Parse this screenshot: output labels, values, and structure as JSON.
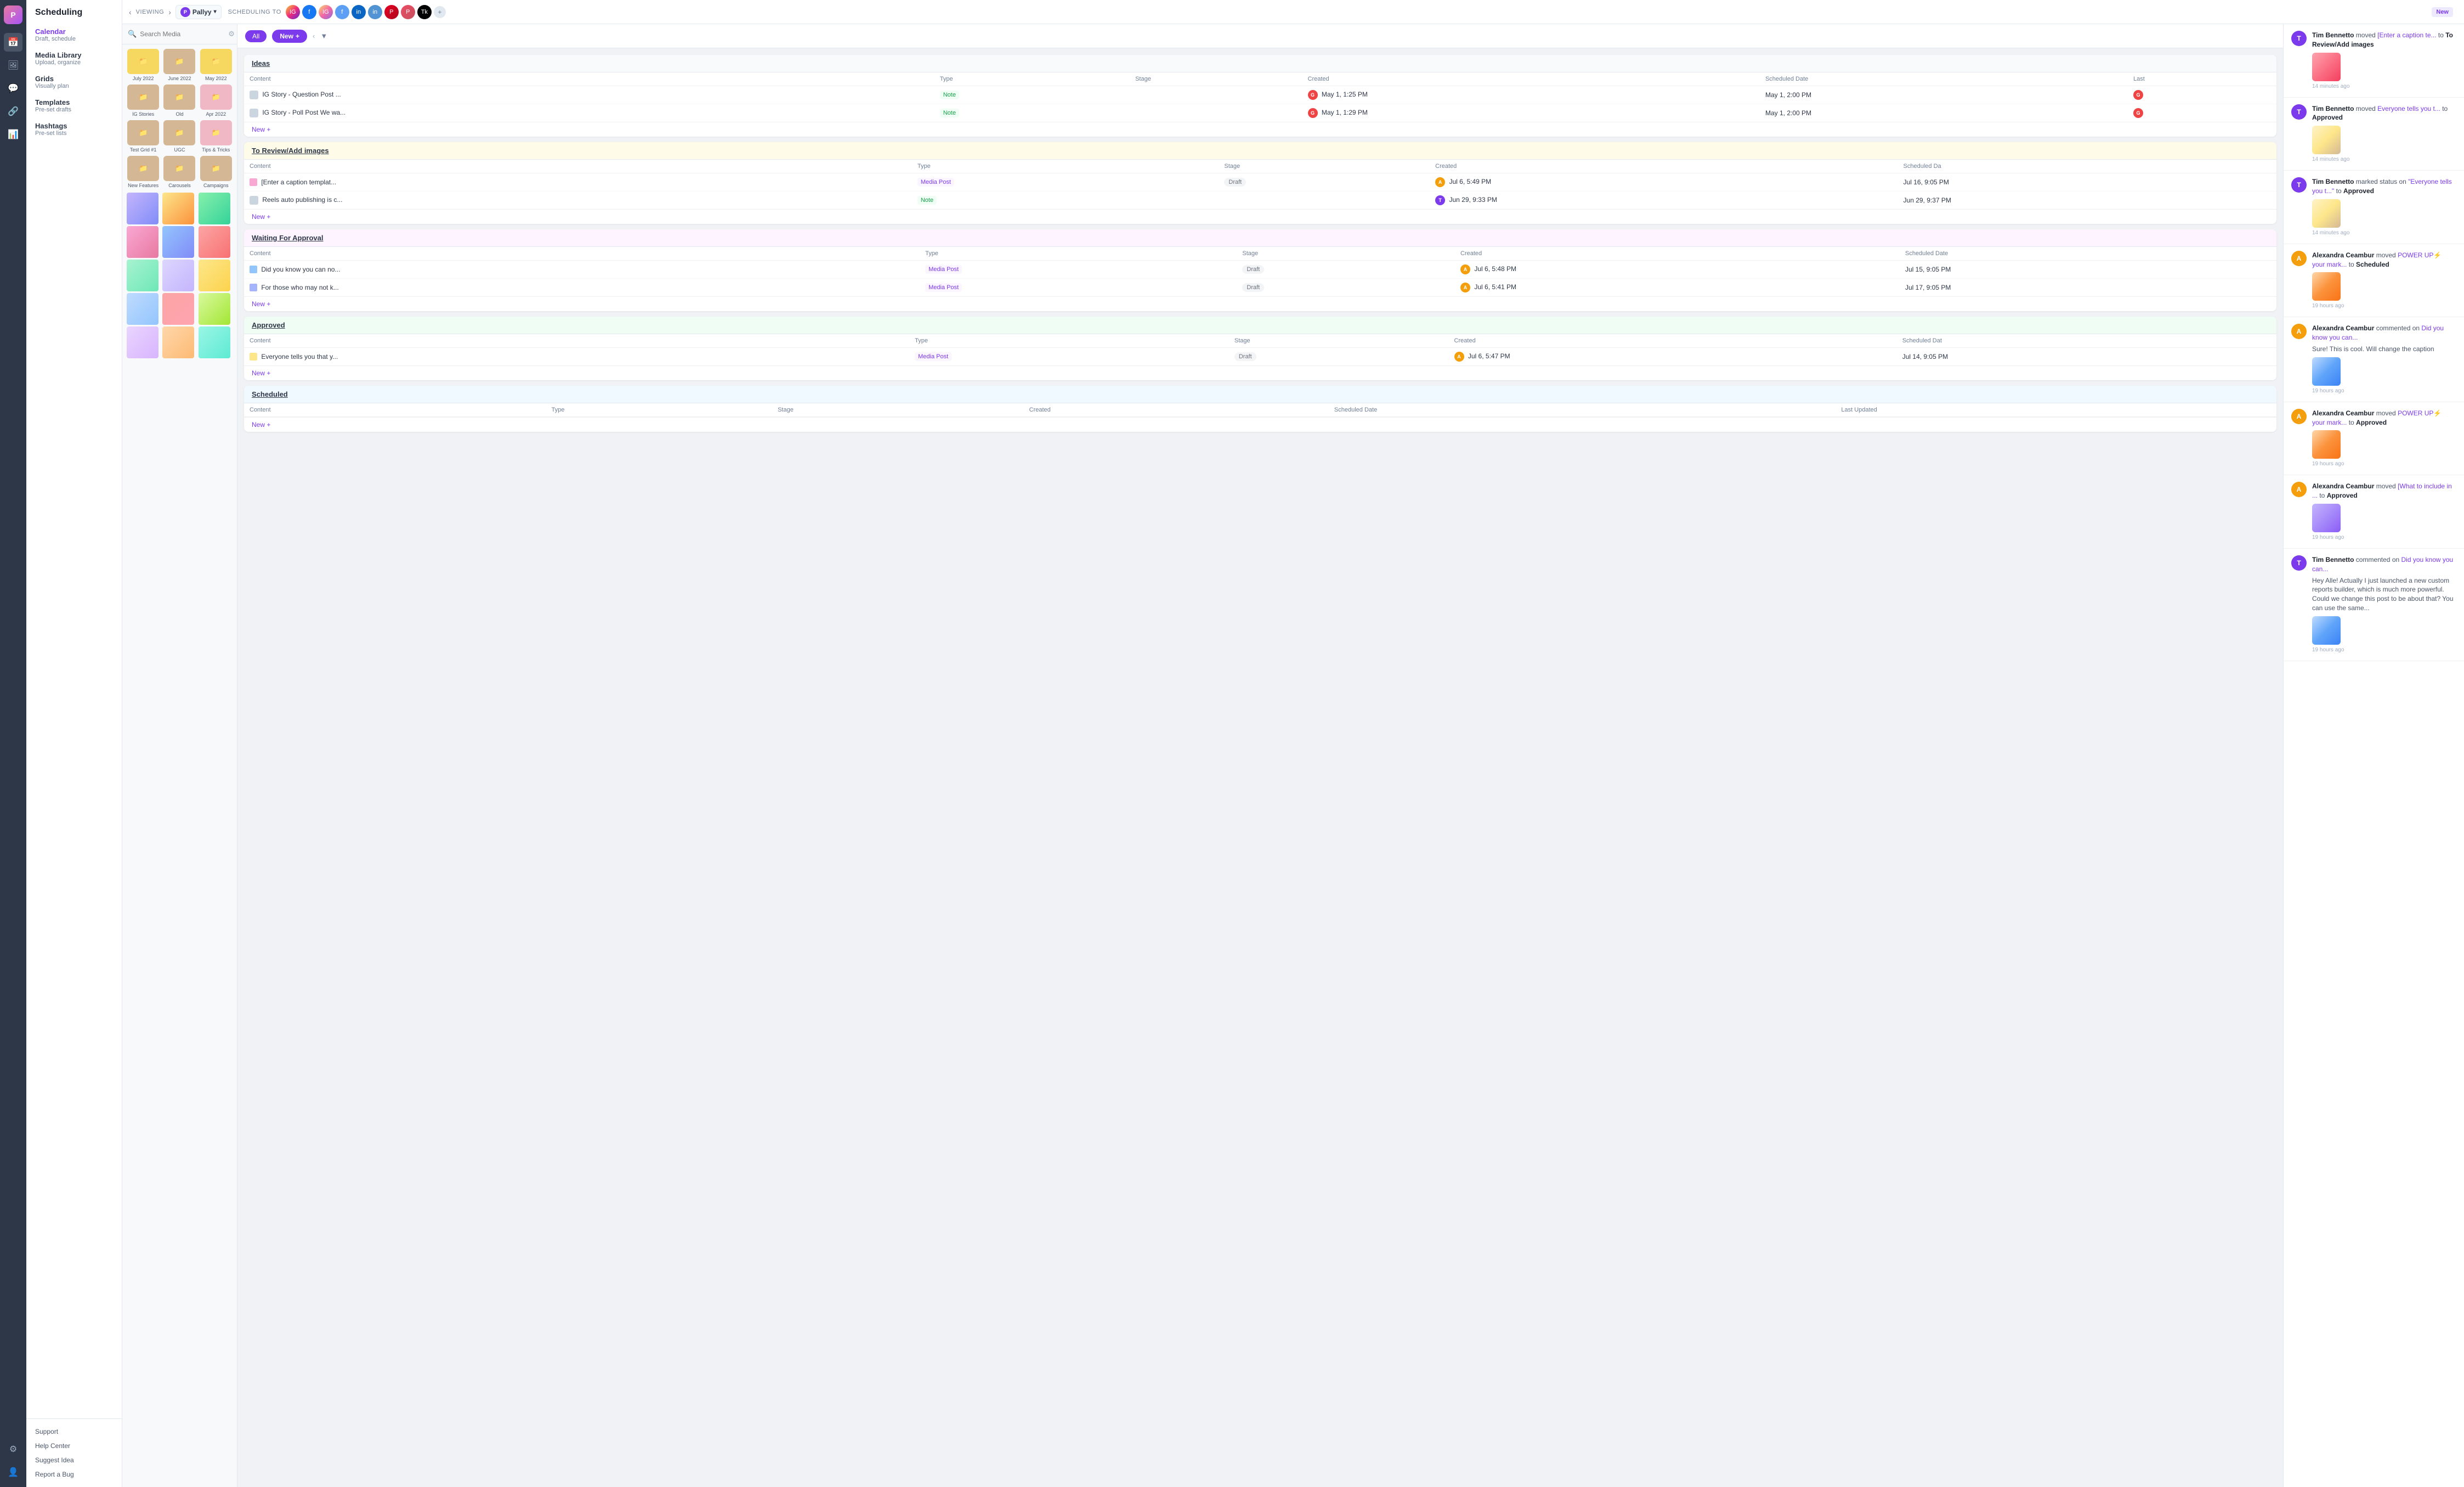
{
  "app": {
    "name": "Scheduling",
    "logo": "P"
  },
  "topbar": {
    "viewing_label": "VIEWING",
    "brand_name": "Pallyy",
    "scheduling_to_label": "SCHEDULING TO",
    "new_button": "New",
    "filter_all": "All",
    "nav_back": "‹",
    "nav_forward": "›"
  },
  "sidebar": {
    "items": [
      {
        "label": "Calendar",
        "sublabel": "Draft, schedule"
      },
      {
        "label": "Media Library",
        "sublabel": "Upload, organize"
      },
      {
        "label": "Grids",
        "sublabel": "Visually plan"
      },
      {
        "label": "Templates",
        "sublabel": "Pre-set drafts"
      },
      {
        "label": "Hashtags",
        "sublabel": "Pre-set lists"
      }
    ],
    "bottom": [
      "Support",
      "Help Center",
      "Suggest Idea",
      "Report a Bug"
    ]
  },
  "media": {
    "search_placeholder": "Search Media",
    "folders": [
      {
        "label": "July 2022",
        "color": "yellow"
      },
      {
        "label": "June 2022",
        "color": "tan"
      },
      {
        "label": "May 2022",
        "color": "yellow"
      },
      {
        "label": "IG Stories",
        "color": "tan"
      },
      {
        "label": "Old",
        "color": "tan"
      },
      {
        "label": "Apr 2022",
        "color": "pink"
      },
      {
        "label": "Test Grid #1",
        "color": "tan"
      },
      {
        "label": "UGC",
        "color": "tan"
      },
      {
        "label": "Tips & Tricks",
        "color": "pink"
      },
      {
        "label": "New Features",
        "color": "tan"
      },
      {
        "label": "Carousels",
        "color": "tan"
      },
      {
        "label": "Campaigns",
        "color": "tan"
      }
    ]
  },
  "kanban": {
    "sections": [
      {
        "id": "ideas",
        "title": "Ideas",
        "columns": [
          "Content",
          "Type",
          "Stage",
          "Created",
          "Scheduled Date",
          "Last"
        ],
        "rows": [
          {
            "content": "IG Story - Question Post ...",
            "type": "Note",
            "type_class": "type-note",
            "stage": "",
            "avatar": "G",
            "avatar_class": "avatar-g",
            "created": "May 1, 1:25 PM",
            "scheduled": "May 1, 2:00 PM",
            "last": "G N"
          },
          {
            "content": "IG Story - Poll Post We wa...",
            "type": "Note",
            "type_class": "type-note",
            "stage": "",
            "avatar": "G",
            "avatar_class": "avatar-g",
            "created": "May 1, 1:29 PM",
            "scheduled": "May 1, 2:00 PM",
            "last": "G N"
          }
        ],
        "new_btn": "New +"
      },
      {
        "id": "review",
        "title": "To Review/Add images",
        "columns": [
          "Content",
          "Type",
          "Stage",
          "Created",
          "Scheduled Da"
        ],
        "rows": [
          {
            "content": "[Enter a caption templat...",
            "type": "Media Post",
            "type_class": "type-media",
            "stage": "Draft",
            "avatar": "A",
            "avatar_class": "avatar-a",
            "created": "Jul 6, 5:49 PM",
            "scheduled": "Jul 16, 9:05 PM",
            "has_thumb": true,
            "thumb_color": "pink"
          },
          {
            "content": "Reels auto publishing is c...",
            "type": "Note",
            "type_class": "type-note",
            "stage": "",
            "avatar": "T",
            "avatar_class": "avatar-t",
            "created": "Jun 29, 9:33 PM",
            "scheduled": "Jun 29, 9:37 PM",
            "has_thumb": false
          }
        ],
        "new_btn": "New +"
      },
      {
        "id": "waiting",
        "title": "Waiting For Approval",
        "columns": [
          "Content",
          "Type",
          "Stage",
          "Created",
          "Scheduled Date"
        ],
        "rows": [
          {
            "content": "Did you know you can no...",
            "type": "Media Post",
            "type_class": "type-media",
            "stage": "Draft",
            "avatar": "A",
            "avatar_class": "avatar-a",
            "created": "Jul 6, 5:48 PM",
            "scheduled": "Jul 15, 9:05 PM"
          },
          {
            "content": "For those who may not k...",
            "type": "Media Post",
            "type_class": "type-media",
            "stage": "Draft",
            "avatar": "A",
            "avatar_class": "avatar-a",
            "created": "Jul 6, 5:41 PM",
            "scheduled": "Jul 17, 9:05 PM"
          }
        ],
        "new_btn": "New +"
      },
      {
        "id": "approved",
        "title": "Approved",
        "columns": [
          "Content",
          "Type",
          "Stage",
          "Created",
          "Scheduled Dat"
        ],
        "rows": [
          {
            "content": "Everyone tells you that y...",
            "type": "Media Post",
            "type_class": "type-media",
            "stage": "Draft",
            "avatar": "A",
            "avatar_class": "avatar-a",
            "created": "Jul 6, 5:47 PM",
            "scheduled": "Jul 14, 9:05 PM"
          }
        ],
        "new_btn": "New +"
      },
      {
        "id": "scheduled",
        "title": "Scheduled",
        "columns": [
          "Content",
          "Type",
          "Stage",
          "Created",
          "Scheduled Date",
          "Last Updated"
        ],
        "rows": [],
        "new_btn": "New +"
      }
    ]
  },
  "activity": {
    "items": [
      {
        "avatar": "T",
        "avatar_class": "av-t",
        "user": "Tim Bennetto",
        "action": "moved",
        "target": "[Enter a caption te...",
        "action2": "to",
        "destination": "To Review/Add images",
        "has_thumb": true,
        "thumb_color": "pink",
        "time": "14 minutes ago"
      },
      {
        "avatar": "T",
        "avatar_class": "av-t",
        "user": "Tim Bennetto",
        "action": "moved",
        "target": "Everyone tells you t...",
        "action2": "to",
        "destination": "Approved",
        "has_thumb": true,
        "thumb_color": "beige",
        "time": "14 minutes ago"
      },
      {
        "avatar": "T",
        "avatar_class": "av-t",
        "user": "Tim Bennetto",
        "action": "marked status on",
        "target": "\"Everyone tells you t...\"",
        "action2": "to",
        "destination": "Approved",
        "has_thumb": true,
        "thumb_color": "beige",
        "time": "14 minutes ago"
      },
      {
        "avatar": "A",
        "avatar_class": "av-a",
        "user": "Alexandra Ceambur",
        "action": "moved",
        "target": "POWER UP⚡ your mark...",
        "action2": "to",
        "destination": "Scheduled",
        "has_thumb": true,
        "thumb_color": "orange",
        "time": "19 hours ago"
      },
      {
        "avatar": "A",
        "avatar_class": "av-a",
        "user": "Alexandra Ceambur",
        "action": "commented on",
        "target": "Did you know you can...",
        "action2": "",
        "destination": "",
        "comment": "Sure! This is cool. Will change the caption",
        "has_thumb": true,
        "thumb_color": "blue2",
        "time": "19 hours ago"
      },
      {
        "avatar": "A",
        "avatar_class": "av-a",
        "user": "Alexandra Ceambur",
        "action": "moved",
        "target": "POWER UP⚡ your mark...",
        "action2": "to",
        "destination": "Approved",
        "has_thumb": true,
        "thumb_color": "orange",
        "time": "19 hours ago"
      },
      {
        "avatar": "A",
        "avatar_class": "av-a",
        "user": "Alexandra Ceambur",
        "action": "moved",
        "target": "[What to include in ...",
        "action2": "to",
        "destination": "Approved",
        "has_thumb": true,
        "thumb_color": "purple2",
        "time": "19 hours ago"
      },
      {
        "avatar": "T",
        "avatar_class": "av-t",
        "user": "Tim Bennetto",
        "action": "commented on",
        "target": "Did you know you can...",
        "action2": "",
        "destination": "",
        "comment": "Hey Alle! Actually I just launched a new custom reports builder, which is much more powerful. Could we change this post to be about that? You can use the same...",
        "has_thumb": true,
        "thumb_color": "blue2",
        "time": "19 hours ago"
      }
    ]
  },
  "icons": {
    "calendar": "📅",
    "media": "🖼",
    "grid": "▦",
    "template": "📄",
    "hashtag": "#",
    "link": "🔗",
    "star": "★",
    "settings": "⚙",
    "user": "👤",
    "back": "‹",
    "forward": "›",
    "filter": "▼",
    "funnel": "⊟",
    "gear": "⚙",
    "plus": "+"
  },
  "social_platforms": [
    {
      "name": "instagram",
      "color": "#e1306c",
      "label": "IG"
    },
    {
      "name": "facebook",
      "color": "#1877f2",
      "label": "FB"
    },
    {
      "name": "linkedin",
      "color": "#0a66c2",
      "label": "in"
    },
    {
      "name": "twitter",
      "color": "#1da1f2",
      "label": "Tw"
    },
    {
      "name": "pinterest",
      "color": "#e60023",
      "label": "Pi"
    },
    {
      "name": "tiktok",
      "color": "#010101",
      "label": "Tk"
    }
  ]
}
